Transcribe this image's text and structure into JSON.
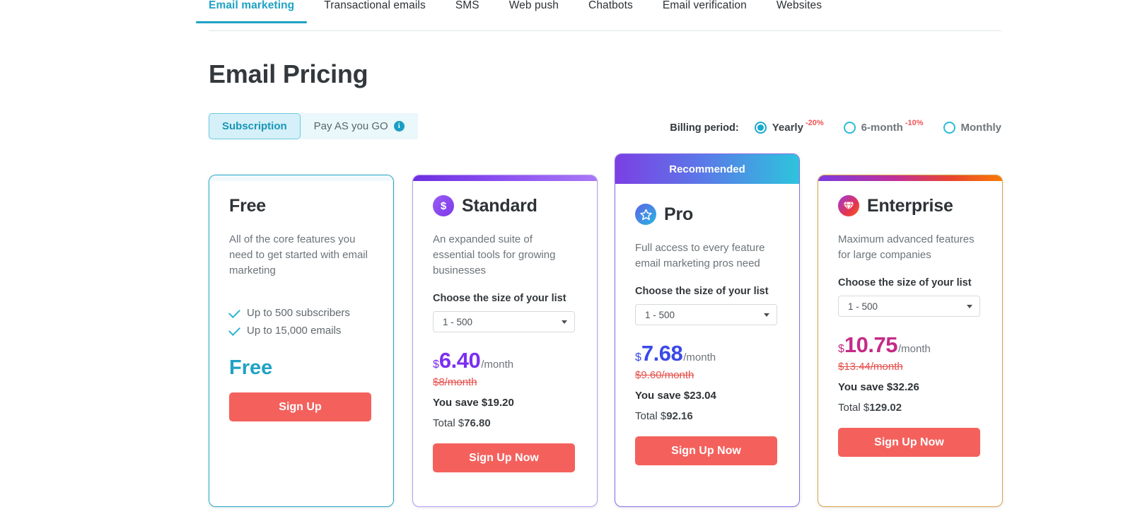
{
  "tabs": [
    {
      "label": "Email marketing",
      "active": true
    },
    {
      "label": "Transactional emails",
      "active": false
    },
    {
      "label": "SMS",
      "active": false
    },
    {
      "label": "Web push",
      "active": false
    },
    {
      "label": "Chatbots",
      "active": false
    },
    {
      "label": "Email verification",
      "active": false
    },
    {
      "label": "Websites",
      "active": false
    }
  ],
  "page_title": "Email Pricing",
  "mode_switch": {
    "subscription_label": "Subscription",
    "payg_label": "Pay AS you GO",
    "info_icon": "info-icon",
    "info_glyph": "i"
  },
  "billing": {
    "label": "Billing period:",
    "options": [
      {
        "label": "Yearly",
        "discount": "-20%",
        "selected": true
      },
      {
        "label": "6-month",
        "discount": "-10%",
        "selected": false
      },
      {
        "label": "Monthly",
        "discount": "",
        "selected": false
      }
    ]
  },
  "recommended_badge": "Recommended",
  "plans": {
    "free": {
      "name": "Free",
      "desc": "All of the core features you need to get started with email marketing",
      "features": [
        "Up to 500 subscribers",
        "Up to 15,000 emails"
      ],
      "price_text": "Free",
      "cta": "Sign Up"
    },
    "standard": {
      "name": "Standard",
      "icon": "dollar-badge-icon",
      "desc": "An expanded suite of essential tools for growing businesses",
      "list_label": "Choose the size of your list",
      "list_value": "1 - 500",
      "currency": "$",
      "amount": "6.40",
      "per": "/month",
      "old_price": "$8/month",
      "save": "You save $19.20",
      "total_prefix": "Total $",
      "total_value": "76.80",
      "cta": "Sign Up Now"
    },
    "pro": {
      "name": "Pro",
      "icon": "star-badge-icon",
      "desc": "Full access to every feature email marketing pros need",
      "list_label": "Choose the size of your list",
      "list_value": "1 - 500",
      "currency": "$",
      "amount": "7.68",
      "per": "/month",
      "old_price": "$9.60/month",
      "save": "You save $23.04",
      "total_prefix": "Total $",
      "total_value": "92.16",
      "cta": "Sign Up Now"
    },
    "enterprise": {
      "name": "Enterprise",
      "icon": "diamond-badge-icon",
      "desc": "Maximum advanced features for large companies",
      "list_label": "Choose the size of your list",
      "list_value": "1 - 500",
      "currency": "$",
      "amount": "10.75",
      "per": "/month",
      "old_price": "$13.44/month",
      "save": "You save $32.26",
      "total_prefix": "Total $",
      "total_value": "129.02",
      "cta": "Sign Up Now"
    }
  },
  "colors": {
    "accent_teal": "#1fa2c4",
    "cta_red": "#f4615d",
    "standard_purple": "#7b2ff0",
    "pro_blue": "#3b4ae8",
    "enterprise_magenta": "#c42b86",
    "discount_red": "#f05454",
    "old_price_red": "#e5504c"
  }
}
